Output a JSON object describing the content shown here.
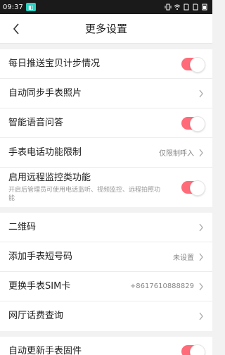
{
  "status_bar": {
    "time": "09:37"
  },
  "nav": {
    "title": "更多设置"
  },
  "groups": [
    {
      "rows": [
        {
          "label": "每日推送宝贝计步情况",
          "type": "toggle",
          "on": true
        },
        {
          "label": "自动同步手表照片",
          "type": "link"
        },
        {
          "label": "智能语音问答",
          "type": "toggle",
          "on": true
        },
        {
          "label": "手表电话功能限制",
          "type": "link",
          "value": "仅限制呼入"
        },
        {
          "label": "启用远程监控类功能",
          "type": "toggle",
          "on": true,
          "sub": "开启后管理员可使用电话监听、视频监控、远程拍照功能"
        }
      ]
    },
    {
      "rows": [
        {
          "label": "二维码",
          "type": "link"
        },
        {
          "label": "添加手表短号码",
          "type": "link",
          "value": "未设置"
        },
        {
          "label": "更换手表SIM卡",
          "type": "link",
          "value": "+8617610888829"
        },
        {
          "label": "网厅话费查询",
          "type": "link"
        }
      ]
    },
    {
      "rows": [
        {
          "label": "自动更新手表固件",
          "type": "toggle",
          "on": true
        }
      ]
    }
  ],
  "colors": {
    "accent": "#ff6b78",
    "status_bar": "#1a1a1a",
    "badge": "#2ecfc0"
  }
}
